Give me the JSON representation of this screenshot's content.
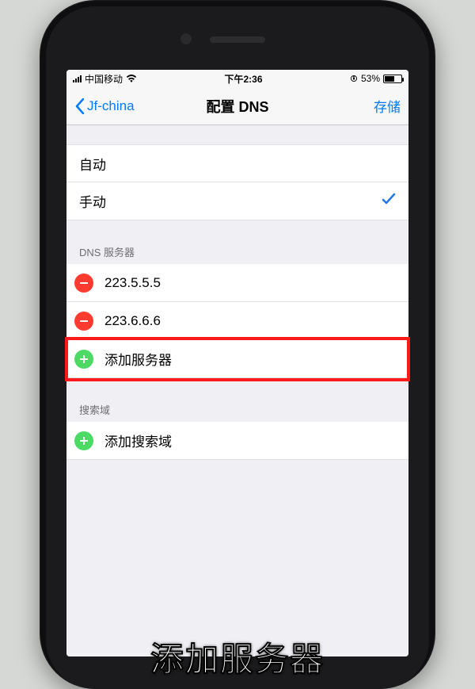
{
  "statusbar": {
    "carrier": "中国移动",
    "time": "下午2:36",
    "battery_pct": "53%"
  },
  "nav": {
    "back_label": "Jf-china",
    "title": "配置 DNS",
    "save_label": "存储"
  },
  "mode_group": {
    "auto_label": "自动",
    "manual_label": "手动"
  },
  "dns_group": {
    "header": "DNS 服务器",
    "servers": [
      "223.5.5.5",
      "223.6.6.6"
    ],
    "add_label": "添加服务器"
  },
  "search_group": {
    "header": "搜索域",
    "add_label": "添加搜索域"
  },
  "caption": "添加服务器"
}
